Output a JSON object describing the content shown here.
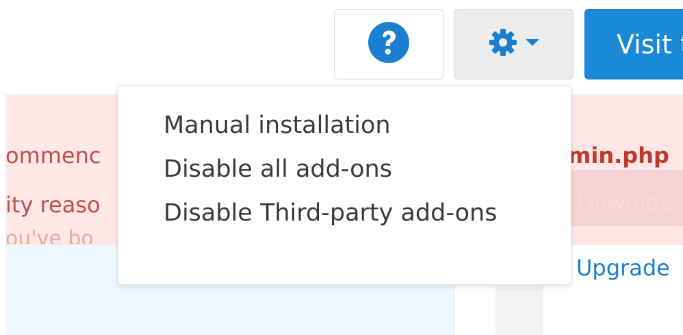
{
  "toolbar": {
    "help_icon": "question-circle-icon",
    "settings_icon": "gear-icon",
    "caret_icon": "caret-down-icon",
    "visit_label": "Visit t"
  },
  "background": {
    "alert_line1_left": "ommenc",
    "alert_line2_left": "ity reaso",
    "alert_line3_left": "ou've bo",
    "alert_right_strong": "min.php",
    "download_label": "Downloa",
    "upgrade_link": "Upgrade"
  },
  "dropdown": {
    "items": [
      {
        "label": "Manual installation"
      },
      {
        "label": "Disable all add-ons"
      },
      {
        "label": "Disable Third-party add-ons"
      }
    ]
  },
  "colors": {
    "primary": "#1a8ad6",
    "icon_blue": "#1a7fd0",
    "alert_text": "#c0504d",
    "alert_bg": "#fde7e7"
  }
}
